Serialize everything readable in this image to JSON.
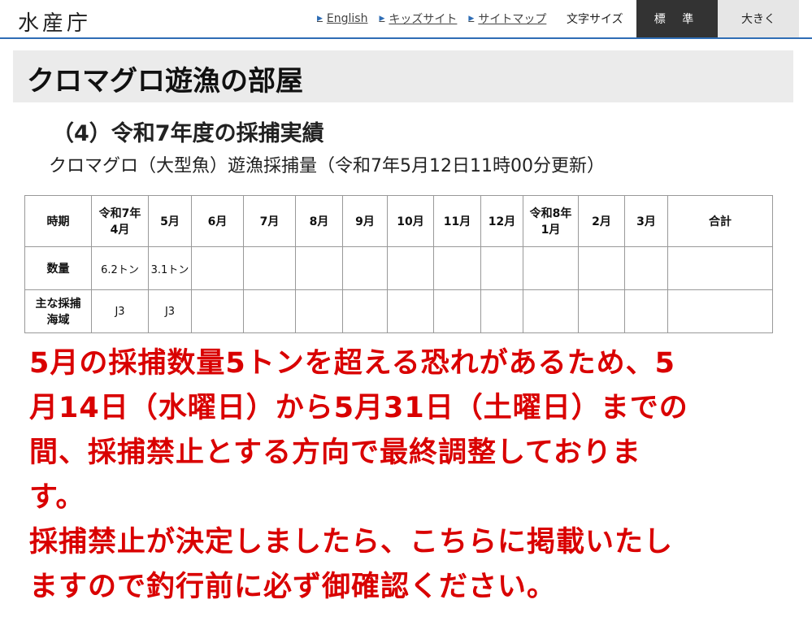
{
  "header": {
    "logo": "水産庁",
    "nav": [
      {
        "label": "English"
      },
      {
        "label": "キッズサイト"
      },
      {
        "label": "サイトマップ"
      }
    ],
    "font_size_label": "文字サイズ",
    "font_size_standard": "標 準",
    "font_size_large": "大きく",
    "accent_color": "#2f6db5"
  },
  "page_title": "クロマグロ遊漁の部屋",
  "section_heading": "（4）令和7年度の採捕実績",
  "subtitle": "クロマグロ（大型魚）遊漁採捕量（令和7年5月12日11時00分更新）",
  "table": {
    "row_header": "時期",
    "months": [
      {
        "line1": "令和7年",
        "line2": "4月"
      },
      {
        "line1": "",
        "line2": "5月"
      },
      {
        "line1": "",
        "line2": "6月"
      },
      {
        "line1": "",
        "line2": "7月"
      },
      {
        "line1": "",
        "line2": "8月"
      },
      {
        "line1": "",
        "line2": "9月"
      },
      {
        "line1": "",
        "line2": "10月"
      },
      {
        "line1": "",
        "line2": "11月"
      },
      {
        "line1": "",
        "line2": "12月"
      },
      {
        "line1": "令和8年",
        "line2": "1月"
      },
      {
        "line1": "",
        "line2": "2月"
      },
      {
        "line1": "",
        "line2": "3月"
      }
    ],
    "total_header": "合計",
    "quantity_label": "数量",
    "quantity": [
      "6.2トン",
      "3.1トン",
      "",
      "",
      "",
      "",
      "",
      "",
      "",
      "",
      "",
      "",
      ""
    ],
    "area_label_line1": "主な採捕",
    "area_label_line2": "海域",
    "area": [
      "J3",
      "J3",
      "",
      "",
      "",
      "",
      "",
      "",
      "",
      "",
      "",
      "",
      ""
    ]
  },
  "notice": {
    "color": "#d90000",
    "lines": [
      "5月の採捕数量5トンを超える恐れがあるため、5",
      "月14日（水曜日）から5月31日（土曜日）までの",
      "間、採捕禁止とする方向で最終調整しておりま",
      "す。",
      "採捕禁止が決定しましたら、こちらに掲載いたし",
      "ますので釣行前に必ず御確認ください。"
    ]
  }
}
